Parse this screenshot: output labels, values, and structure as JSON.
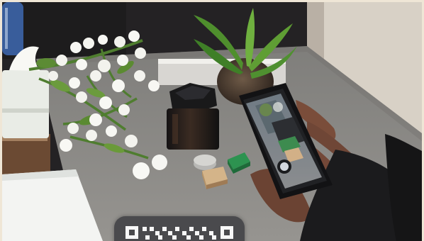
{
  "photo": {
    "kind": "product photography scene",
    "subjects": [
      "white-roses",
      "black-perfume-bottle",
      "potted-plant",
      "smartphone-camera-preview",
      "hand",
      "tissue-box",
      "water-bottle",
      "green-block",
      "gold-block",
      "silver-block"
    ]
  },
  "overlay": {
    "type": "qr-code-badge",
    "color": "#4a4a4d"
  },
  "colors": {
    "table": "#8c8a87",
    "wall": "#2a282a",
    "background_panel": "#e8e2d7",
    "rose": "#f4f4ef",
    "leaf": "#4f7d2f",
    "phone_body": "#1a1a1c"
  }
}
